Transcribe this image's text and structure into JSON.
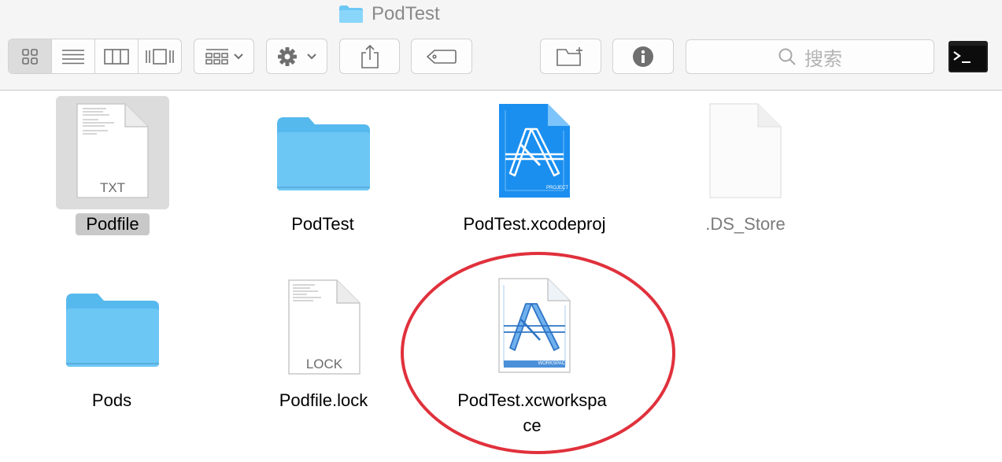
{
  "window": {
    "title": "PodTest"
  },
  "toolbar": {
    "view_modes": [
      "icon-view",
      "list-view",
      "column-view",
      "cover-flow-view"
    ],
    "search_placeholder": "搜索"
  },
  "files": [
    {
      "name": "Podfile",
      "type_badge": "TXT",
      "kind": "text-document"
    },
    {
      "name": "PodTest",
      "kind": "folder"
    },
    {
      "name": "PodTest.xcodeproj",
      "type_badge": "PROJECT",
      "kind": "xcode-project"
    },
    {
      "name": ".DS_Store",
      "kind": "blank-document"
    },
    {
      "name": "Pods",
      "kind": "folder"
    },
    {
      "name": "Podfile.lock",
      "type_badge": "LOCK",
      "kind": "text-document"
    },
    {
      "name_line1": "PodTest.xcworkspa",
      "name_line2": "ce",
      "type_badge": "WORKSPACE",
      "kind": "xcode-workspace"
    }
  ],
  "colors": {
    "folder": "#6cc7f5",
    "annotation": "#e0313c",
    "selection": "#dcdcdc"
  }
}
